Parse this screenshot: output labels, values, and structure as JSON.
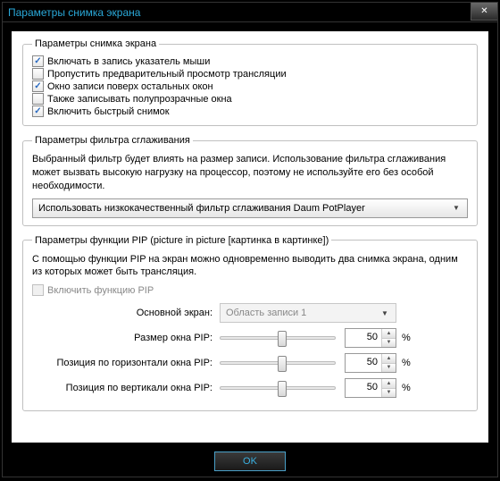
{
  "window": {
    "title": "Параметры снимка экрана",
    "ok": "OK"
  },
  "capture": {
    "legend": "Параметры снимка экрана",
    "opts": [
      {
        "label": "Включать в запись указатель мыши",
        "checked": true
      },
      {
        "label": "Пропустить предварительный просмотр трансляции",
        "checked": false
      },
      {
        "label": "Окно записи поверх остальных окон",
        "checked": true
      },
      {
        "label": "Также записывать полупрозрачные окна",
        "checked": false
      },
      {
        "label": "Включить быстрый снимок",
        "checked": true
      }
    ]
  },
  "filter": {
    "legend": "Параметры фильтра сглаживания",
    "desc": "Выбранный фильтр будет влиять на размер записи. Использование фильтра сглаживания может вызвать высокую нагрузку на процессор, поэтому не используйте его без особой необходимости.",
    "value": "Использовать низкокачественный фильтр сглаживания Daum PotPlayer"
  },
  "pip": {
    "legend": "Параметры функции PIP (picture in picture [картинка в картинке])",
    "desc": "С помощью функции PIP на экран можно одновременно выводить два снимка экрана, одним из которых может быть трансляция.",
    "enable_label": "Включить функцию PIP",
    "enable_checked": false,
    "main_label": "Основной экран:",
    "main_value": "Область записи 1",
    "size_label": "Размер окна PIP:",
    "size_value": 50,
    "hpos_label": "Позиция по горизонтали окна PIP:",
    "hpos_value": 50,
    "vpos_label": "Позиция по вертикали окна PIP:",
    "vpos_value": 50,
    "pct": "%"
  }
}
